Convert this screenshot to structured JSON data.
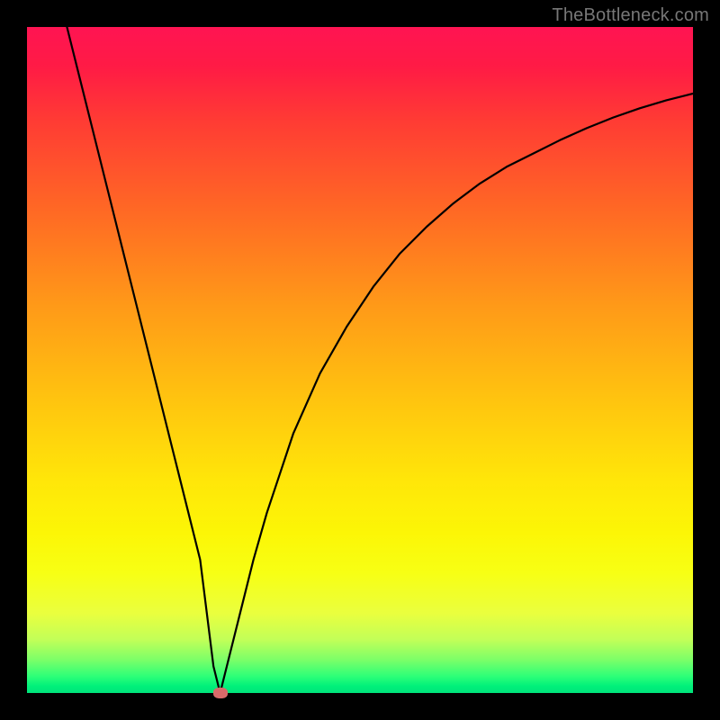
{
  "watermark": "TheBottleneck.com",
  "chart_data": {
    "type": "line",
    "title": "",
    "xlabel": "",
    "ylabel": "",
    "xlim": [
      0,
      100
    ],
    "ylim": [
      0,
      100
    ],
    "grid": false,
    "series": [
      {
        "name": "bottleneck-curve",
        "x": [
          6,
          8,
          10,
          12,
          14,
          16,
          18,
          20,
          22,
          24,
          25,
          26,
          27,
          28,
          29,
          30,
          32,
          34,
          36,
          38,
          40,
          44,
          48,
          52,
          56,
          60,
          64,
          68,
          72,
          76,
          80,
          84,
          88,
          92,
          96,
          100
        ],
        "y": [
          100,
          92,
          84,
          76,
          68,
          60,
          52,
          44,
          36,
          28,
          24,
          20,
          12,
          4,
          0,
          4,
          12,
          20,
          27,
          33,
          39,
          48,
          55,
          61,
          66,
          70,
          73.5,
          76.5,
          79,
          81,
          83,
          84.8,
          86.4,
          87.8,
          89,
          90
        ]
      }
    ],
    "annotations": [
      {
        "name": "optimum-marker",
        "x": 29,
        "y": 0
      }
    ],
    "gradient_stops": [
      {
        "pos": 0,
        "color": "#ff1452"
      },
      {
        "pos": 50,
        "color": "#ffc40f"
      },
      {
        "pos": 80,
        "color": "#fcf606"
      },
      {
        "pos": 100,
        "color": "#00e47b"
      }
    ]
  }
}
